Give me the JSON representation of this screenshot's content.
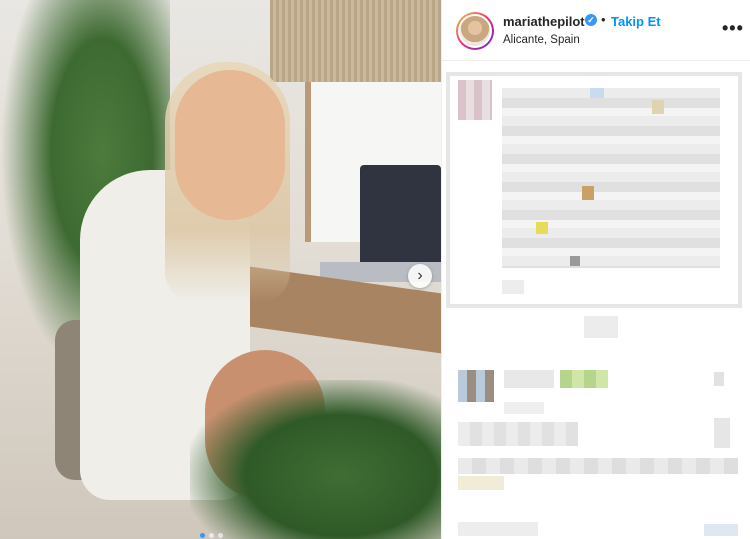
{
  "post": {
    "username": "mariathepilot",
    "follow_label": "Takip Et",
    "location": "Alicante, Spain",
    "separator": "•",
    "verified_glyph": "✓",
    "more_glyph": "•••",
    "next_glyph": "›"
  },
  "colors": {
    "accent": "#0095f6",
    "verified": "#3897f0",
    "text": "#262626"
  },
  "icons": {
    "verified": "verified-badge-icon",
    "more": "more-options-icon",
    "next": "chevron-right-icon"
  }
}
